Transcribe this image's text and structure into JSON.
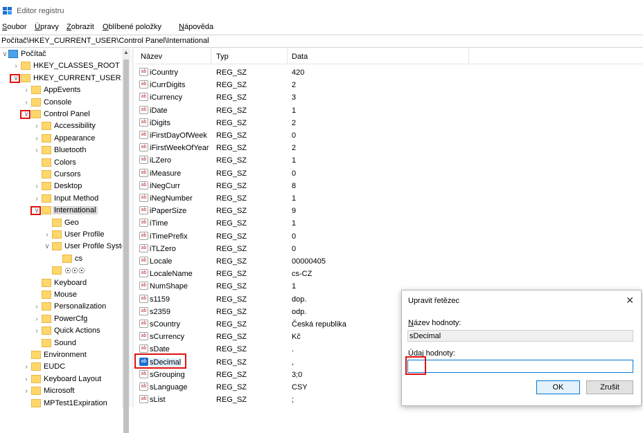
{
  "window": {
    "title": "Editor registru",
    "icon": "regedit-icon"
  },
  "menu": [
    {
      "key": "S",
      "rest": "oubor"
    },
    {
      "key": "Ú",
      "rest": "pravy"
    },
    {
      "key": "Z",
      "rest": "obrazit"
    },
    {
      "key": "O",
      "rest": "blíbené položky"
    },
    {
      "key": "N",
      "rest": "ápověda"
    }
  ],
  "address": "Počítač\\HKEY_CURRENT_USER\\Control Panel\\International",
  "tree": [
    {
      "label": "Počítač",
      "level": 0,
      "expanded": true,
      "computer": true
    },
    {
      "label": "HKEY_CLASSES_ROOT",
      "level": 1,
      "expander": ">"
    },
    {
      "label": "HKEY_CURRENT_USER",
      "level": 1,
      "expander": "v",
      "marked": true
    },
    {
      "label": "AppEvents",
      "level": 2,
      "expander": ">"
    },
    {
      "label": "Console",
      "level": 2,
      "expander": ">"
    },
    {
      "label": "Control Panel",
      "level": 2,
      "expander": "v",
      "marked": true
    },
    {
      "label": "Accessibility",
      "level": 3,
      "expander": ">"
    },
    {
      "label": "Appearance",
      "level": 3,
      "expander": ">"
    },
    {
      "label": "Bluetooth",
      "level": 3,
      "expander": ">"
    },
    {
      "label": "Colors",
      "level": 3,
      "expander": ""
    },
    {
      "label": "Cursors",
      "level": 3,
      "expander": ""
    },
    {
      "label": "Desktop",
      "level": 3,
      "expander": ">"
    },
    {
      "label": "Input Method",
      "level": 3,
      "expander": ">"
    },
    {
      "label": "International",
      "level": 3,
      "expander": "v",
      "marked": true,
      "selected": true
    },
    {
      "label": "Geo",
      "level": 4,
      "expander": ""
    },
    {
      "label": "User Profile",
      "level": 4,
      "expander": ">"
    },
    {
      "label": "User Profile Syste",
      "level": 4,
      "expander": "v"
    },
    {
      "label": "cs",
      "level": 5,
      "expander": ""
    },
    {
      "label": "☉☉☉",
      "level": 4,
      "expander": ""
    },
    {
      "label": "Keyboard",
      "level": 3,
      "expander": ""
    },
    {
      "label": "Mouse",
      "level": 3,
      "expander": ""
    },
    {
      "label": "Personalization",
      "level": 3,
      "expander": ">"
    },
    {
      "label": "PowerCfg",
      "level": 3,
      "expander": ">"
    },
    {
      "label": "Quick Actions",
      "level": 3,
      "expander": ">"
    },
    {
      "label": "Sound",
      "level": 3,
      "expander": ""
    },
    {
      "label": "Environment",
      "level": 2,
      "expander": ""
    },
    {
      "label": "EUDC",
      "level": 2,
      "expander": ">"
    },
    {
      "label": "Keyboard Layout",
      "level": 2,
      "expander": ">"
    },
    {
      "label": "Microsoft",
      "level": 2,
      "expander": ">"
    },
    {
      "label": "MPTest1Expiration",
      "level": 2,
      "expander": ""
    }
  ],
  "list": {
    "columns": {
      "name": "Název",
      "type": "Typ",
      "data": "Data"
    },
    "rows": [
      {
        "name": "iCountry",
        "type": "REG_SZ",
        "data": "420"
      },
      {
        "name": "iCurrDigits",
        "type": "REG_SZ",
        "data": "2"
      },
      {
        "name": "iCurrency",
        "type": "REG_SZ",
        "data": "3"
      },
      {
        "name": "iDate",
        "type": "REG_SZ",
        "data": "1"
      },
      {
        "name": "iDigits",
        "type": "REG_SZ",
        "data": "2"
      },
      {
        "name": "iFirstDayOfWeek",
        "type": "REG_SZ",
        "data": "0"
      },
      {
        "name": "iFirstWeekOfYear",
        "type": "REG_SZ",
        "data": "2"
      },
      {
        "name": "iLZero",
        "type": "REG_SZ",
        "data": "1"
      },
      {
        "name": "iMeasure",
        "type": "REG_SZ",
        "data": "0"
      },
      {
        "name": "iNegCurr",
        "type": "REG_SZ",
        "data": "8"
      },
      {
        "name": "iNegNumber",
        "type": "REG_SZ",
        "data": "1"
      },
      {
        "name": "iPaperSize",
        "type": "REG_SZ",
        "data": "9"
      },
      {
        "name": "iTime",
        "type": "REG_SZ",
        "data": "1"
      },
      {
        "name": "iTimePrefix",
        "type": "REG_SZ",
        "data": "0"
      },
      {
        "name": "iTLZero",
        "type": "REG_SZ",
        "data": "0"
      },
      {
        "name": "Locale",
        "type": "REG_SZ",
        "data": "00000405"
      },
      {
        "name": "LocaleName",
        "type": "REG_SZ",
        "data": "cs-CZ"
      },
      {
        "name": "NumShape",
        "type": "REG_SZ",
        "data": "1"
      },
      {
        "name": "s1159",
        "type": "REG_SZ",
        "data": "dop."
      },
      {
        "name": "s2359",
        "type": "REG_SZ",
        "data": "odp."
      },
      {
        "name": "sCountry",
        "type": "REG_SZ",
        "data": "Česká republika"
      },
      {
        "name": "sCurrency",
        "type": "REG_SZ",
        "data": "Kč"
      },
      {
        "name": "sDate",
        "type": "REG_SZ",
        "data": "."
      },
      {
        "name": "sDecimal",
        "type": "REG_SZ",
        "data": ",",
        "selected": true
      },
      {
        "name": "sGrouping",
        "type": "REG_SZ",
        "data": "3;0"
      },
      {
        "name": "sLanguage",
        "type": "REG_SZ",
        "data": "CSY"
      },
      {
        "name": "sList",
        "type": "REG_SZ",
        "data": ";"
      }
    ]
  },
  "dialog": {
    "title": "Upravit řetězec",
    "value_name_label": "Název hodnoty:",
    "value_name_underline": "N",
    "value_name": "sDecimal",
    "value_data_label": "Údaj hodnoty:",
    "value_data": "",
    "ok_label": "OK",
    "cancel_label": "Zrušit"
  },
  "colors": {
    "highlight": "#e01010",
    "accent": "#0078d7",
    "folder": "#ffd76a"
  }
}
